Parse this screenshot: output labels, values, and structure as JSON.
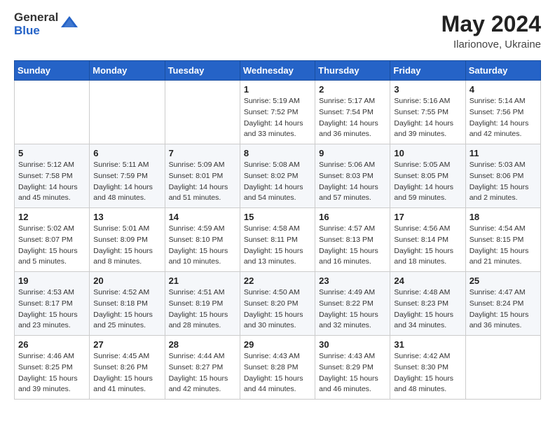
{
  "header": {
    "logo_general": "General",
    "logo_blue": "Blue",
    "month_year": "May 2024",
    "location": "Ilarionove, Ukraine"
  },
  "days_of_week": [
    "Sunday",
    "Monday",
    "Tuesday",
    "Wednesday",
    "Thursday",
    "Friday",
    "Saturday"
  ],
  "weeks": [
    [
      {
        "day": "",
        "sunrise": "",
        "sunset": "",
        "daylight": ""
      },
      {
        "day": "",
        "sunrise": "",
        "sunset": "",
        "daylight": ""
      },
      {
        "day": "",
        "sunrise": "",
        "sunset": "",
        "daylight": ""
      },
      {
        "day": "1",
        "sunrise": "Sunrise: 5:19 AM",
        "sunset": "Sunset: 7:52 PM",
        "daylight": "Daylight: 14 hours and 33 minutes."
      },
      {
        "day": "2",
        "sunrise": "Sunrise: 5:17 AM",
        "sunset": "Sunset: 7:54 PM",
        "daylight": "Daylight: 14 hours and 36 minutes."
      },
      {
        "day": "3",
        "sunrise": "Sunrise: 5:16 AM",
        "sunset": "Sunset: 7:55 PM",
        "daylight": "Daylight: 14 hours and 39 minutes."
      },
      {
        "day": "4",
        "sunrise": "Sunrise: 5:14 AM",
        "sunset": "Sunset: 7:56 PM",
        "daylight": "Daylight: 14 hours and 42 minutes."
      }
    ],
    [
      {
        "day": "5",
        "sunrise": "Sunrise: 5:12 AM",
        "sunset": "Sunset: 7:58 PM",
        "daylight": "Daylight: 14 hours and 45 minutes."
      },
      {
        "day": "6",
        "sunrise": "Sunrise: 5:11 AM",
        "sunset": "Sunset: 7:59 PM",
        "daylight": "Daylight: 14 hours and 48 minutes."
      },
      {
        "day": "7",
        "sunrise": "Sunrise: 5:09 AM",
        "sunset": "Sunset: 8:01 PM",
        "daylight": "Daylight: 14 hours and 51 minutes."
      },
      {
        "day": "8",
        "sunrise": "Sunrise: 5:08 AM",
        "sunset": "Sunset: 8:02 PM",
        "daylight": "Daylight: 14 hours and 54 minutes."
      },
      {
        "day": "9",
        "sunrise": "Sunrise: 5:06 AM",
        "sunset": "Sunset: 8:03 PM",
        "daylight": "Daylight: 14 hours and 57 minutes."
      },
      {
        "day": "10",
        "sunrise": "Sunrise: 5:05 AM",
        "sunset": "Sunset: 8:05 PM",
        "daylight": "Daylight: 14 hours and 59 minutes."
      },
      {
        "day": "11",
        "sunrise": "Sunrise: 5:03 AM",
        "sunset": "Sunset: 8:06 PM",
        "daylight": "Daylight: 15 hours and 2 minutes."
      }
    ],
    [
      {
        "day": "12",
        "sunrise": "Sunrise: 5:02 AM",
        "sunset": "Sunset: 8:07 PM",
        "daylight": "Daylight: 15 hours and 5 minutes."
      },
      {
        "day": "13",
        "sunrise": "Sunrise: 5:01 AM",
        "sunset": "Sunset: 8:09 PM",
        "daylight": "Daylight: 15 hours and 8 minutes."
      },
      {
        "day": "14",
        "sunrise": "Sunrise: 4:59 AM",
        "sunset": "Sunset: 8:10 PM",
        "daylight": "Daylight: 15 hours and 10 minutes."
      },
      {
        "day": "15",
        "sunrise": "Sunrise: 4:58 AM",
        "sunset": "Sunset: 8:11 PM",
        "daylight": "Daylight: 15 hours and 13 minutes."
      },
      {
        "day": "16",
        "sunrise": "Sunrise: 4:57 AM",
        "sunset": "Sunset: 8:13 PM",
        "daylight": "Daylight: 15 hours and 16 minutes."
      },
      {
        "day": "17",
        "sunrise": "Sunrise: 4:56 AM",
        "sunset": "Sunset: 8:14 PM",
        "daylight": "Daylight: 15 hours and 18 minutes."
      },
      {
        "day": "18",
        "sunrise": "Sunrise: 4:54 AM",
        "sunset": "Sunset: 8:15 PM",
        "daylight": "Daylight: 15 hours and 21 minutes."
      }
    ],
    [
      {
        "day": "19",
        "sunrise": "Sunrise: 4:53 AM",
        "sunset": "Sunset: 8:17 PM",
        "daylight": "Daylight: 15 hours and 23 minutes."
      },
      {
        "day": "20",
        "sunrise": "Sunrise: 4:52 AM",
        "sunset": "Sunset: 8:18 PM",
        "daylight": "Daylight: 15 hours and 25 minutes."
      },
      {
        "day": "21",
        "sunrise": "Sunrise: 4:51 AM",
        "sunset": "Sunset: 8:19 PM",
        "daylight": "Daylight: 15 hours and 28 minutes."
      },
      {
        "day": "22",
        "sunrise": "Sunrise: 4:50 AM",
        "sunset": "Sunset: 8:20 PM",
        "daylight": "Daylight: 15 hours and 30 minutes."
      },
      {
        "day": "23",
        "sunrise": "Sunrise: 4:49 AM",
        "sunset": "Sunset: 8:22 PM",
        "daylight": "Daylight: 15 hours and 32 minutes."
      },
      {
        "day": "24",
        "sunrise": "Sunrise: 4:48 AM",
        "sunset": "Sunset: 8:23 PM",
        "daylight": "Daylight: 15 hours and 34 minutes."
      },
      {
        "day": "25",
        "sunrise": "Sunrise: 4:47 AM",
        "sunset": "Sunset: 8:24 PM",
        "daylight": "Daylight: 15 hours and 36 minutes."
      }
    ],
    [
      {
        "day": "26",
        "sunrise": "Sunrise: 4:46 AM",
        "sunset": "Sunset: 8:25 PM",
        "daylight": "Daylight: 15 hours and 39 minutes."
      },
      {
        "day": "27",
        "sunrise": "Sunrise: 4:45 AM",
        "sunset": "Sunset: 8:26 PM",
        "daylight": "Daylight: 15 hours and 41 minutes."
      },
      {
        "day": "28",
        "sunrise": "Sunrise: 4:44 AM",
        "sunset": "Sunset: 8:27 PM",
        "daylight": "Daylight: 15 hours and 42 minutes."
      },
      {
        "day": "29",
        "sunrise": "Sunrise: 4:43 AM",
        "sunset": "Sunset: 8:28 PM",
        "daylight": "Daylight: 15 hours and 44 minutes."
      },
      {
        "day": "30",
        "sunrise": "Sunrise: 4:43 AM",
        "sunset": "Sunset: 8:29 PM",
        "daylight": "Daylight: 15 hours and 46 minutes."
      },
      {
        "day": "31",
        "sunrise": "Sunrise: 4:42 AM",
        "sunset": "Sunset: 8:30 PM",
        "daylight": "Daylight: 15 hours and 48 minutes."
      },
      {
        "day": "",
        "sunrise": "",
        "sunset": "",
        "daylight": ""
      }
    ]
  ]
}
